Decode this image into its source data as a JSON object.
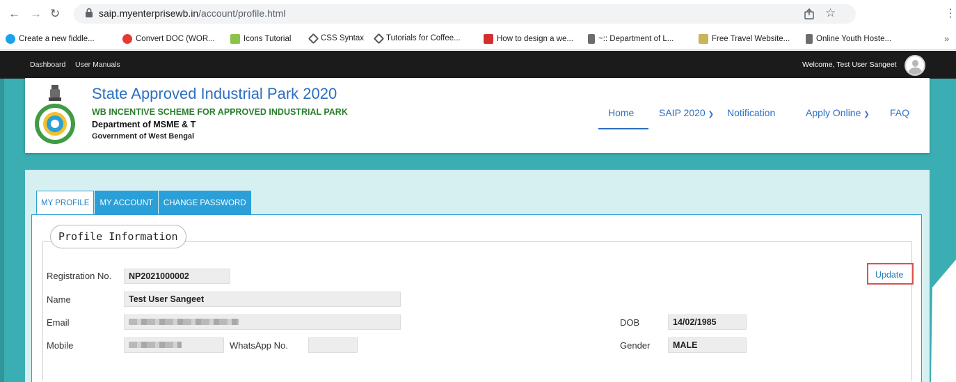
{
  "browser": {
    "url_host": "saip.myenterprisewb.in",
    "url_path": "/account/profile.html",
    "bookmarks": [
      {
        "label": "Create a new fiddle...",
        "color": "#1aa3e8"
      },
      {
        "label": "Convert DOC (WOR...",
        "color": "#e53935"
      },
      {
        "label": "Icons Tutorial",
        "color": "#8bc34a"
      },
      {
        "label": "CSS Syntax",
        "color": "#555555"
      },
      {
        "label": "Tutorials for Coffee...",
        "color": "#555555"
      },
      {
        "label": "How to design a we...",
        "color": "#d32f2f"
      },
      {
        "label": "~:: Department of L...",
        "color": "#6d6d6d"
      },
      {
        "label": "Free Travel Website...",
        "color": "#c9b458"
      },
      {
        "label": "Online Youth Hoste...",
        "color": "#6d6d6d"
      }
    ],
    "more_glyph": "»"
  },
  "topbar": {
    "links": [
      "Dashboard",
      "User Manuals"
    ],
    "welcome": "Welcome, Test User Sangeet"
  },
  "header": {
    "title": "State Approved Industrial Park 2020",
    "subtitle": "WB INCENTIVE SCHEME FOR APPROVED INDUSTRIAL PARK",
    "department": "Department of MSME & T",
    "government": "Government of West Bengal",
    "nav": [
      {
        "label": "Home",
        "active": true
      },
      {
        "label": "SAIP 2020",
        "dropdown": true
      },
      {
        "label": "Notification"
      },
      {
        "label": "Apply Online",
        "dropdown": true
      },
      {
        "label": "FAQ"
      }
    ]
  },
  "tabs": [
    "MY PROFILE",
    "MY ACCOUNT",
    "CHANGE PASSWORD"
  ],
  "profile": {
    "legend": "Profile Information",
    "update_label": "Update",
    "labels": {
      "registration": "Registration No.",
      "name": "Name",
      "email": "Email",
      "mobile": "Mobile",
      "whatsapp": "WhatsApp No.",
      "dob": "DOB",
      "gender": "Gender"
    },
    "values": {
      "registration": "NP2021000002",
      "name": "Test User Sangeet",
      "dob": "14/02/1985",
      "gender": "MALE",
      "whatsapp": ""
    }
  },
  "colors": {
    "site_bg": "#3aaeb2",
    "brand_blue": "#2d6fc0",
    "brand_green": "#2a7d2e",
    "tab_blue": "#2a9fd8",
    "highlight_red": "#d9534f"
  }
}
